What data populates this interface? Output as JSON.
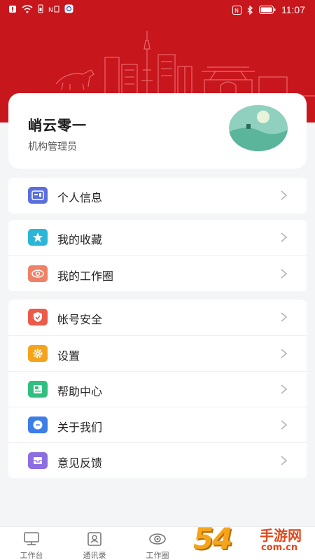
{
  "status_bar": {
    "time": "11:07",
    "left_icons": [
      "notification-icon",
      "wifi-icon",
      "battery-saver-icon",
      "nfc-icon",
      "shield-icon"
    ],
    "right_icons": [
      "nfc-icon",
      "bluetooth-icon",
      "battery-icon"
    ]
  },
  "profile": {
    "name": "峭云零一",
    "role": "机构管理员"
  },
  "groups": [
    {
      "items": [
        {
          "label": "个人信息",
          "icon": "id-card-icon",
          "color": "#5b6fdc"
        }
      ]
    },
    {
      "items": [
        {
          "label": "我的收藏",
          "icon": "star-icon",
          "color": "#2bb6d8"
        },
        {
          "label": "我的工作圈",
          "icon": "eye-icon",
          "color": "#ef8167"
        }
      ]
    },
    {
      "items": [
        {
          "label": "帐号安全",
          "icon": "shield-check-icon",
          "color": "#ea5b4a"
        },
        {
          "label": "设置",
          "icon": "gear-icon",
          "color": "#f5a31a"
        },
        {
          "label": "帮助中心",
          "icon": "help-book-icon",
          "color": "#2fbf7f"
        },
        {
          "label": "关于我们",
          "icon": "chat-icon",
          "color": "#3c7de8"
        },
        {
          "label": "意见反馈",
          "icon": "feedback-box-icon",
          "color": "#8c6ee0"
        }
      ]
    }
  ],
  "tabbar": {
    "tabs": [
      {
        "label": "工作台",
        "icon": "monitor-icon"
      },
      {
        "label": "通讯录",
        "icon": "contacts-icon"
      },
      {
        "label": "工作圈",
        "icon": "eye-icon"
      }
    ]
  },
  "watermark": {
    "digits": "54",
    "brand": "手游网",
    "url": "com.cn"
  },
  "colors": {
    "header_red": "#c8161d",
    "background": "#f4f5f7"
  }
}
